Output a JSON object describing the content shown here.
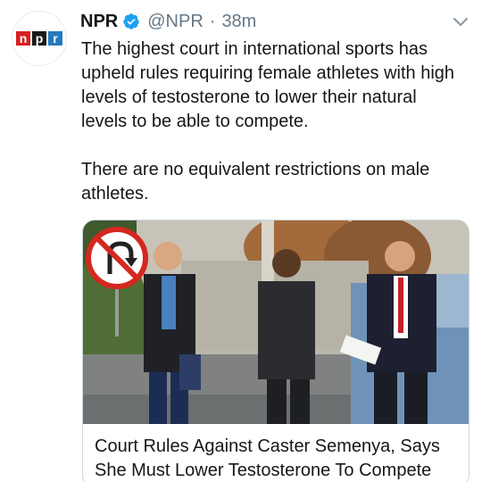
{
  "account": {
    "name": "NPR",
    "handle": "@NPR",
    "separator": "·",
    "time": "38m",
    "logo_letters": [
      "n",
      "p",
      "r"
    ],
    "verified": true
  },
  "tweet": {
    "paragraph_1": "The highest court in international sports has upheld rules requiring female athletes with high levels of testosterone to lower their natural levels to be able to compete.",
    "paragraph_2": "There are no equivalent restrictions on male athletes."
  },
  "card": {
    "title": "Court Rules Against Caster Semenya, Says She Must Lower Testosterone To Compete",
    "image_subject": "photo-of-people-walking-on-street"
  },
  "icons": {
    "verified": "verified-badge-icon",
    "menu": "chevron-down-icon"
  },
  "colors": {
    "verified_blue": "#1da1f2",
    "secondary_text": "#657786",
    "npr_red": "#d62021",
    "npr_black": "#1a1a1a",
    "npr_blue": "#237bbd"
  }
}
